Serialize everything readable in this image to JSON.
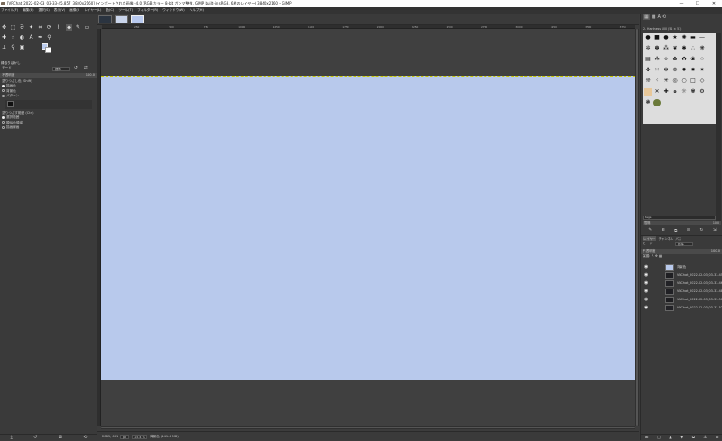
{
  "titlebar": {
    "title": "[VRChat_2022-02-03_03-33-45.857_3840x2160] (インポートされた画像)-4.0 (RGB カラー 8-bit ガンマ整数, GIMP built-in sRGB, 6枚のレイヤー) 3840x2160 – GIMP",
    "min": "—",
    "max": "☐",
    "close": "✕"
  },
  "menubar": {
    "items": [
      "ファイル(F)",
      "編集(E)",
      "選択(S)",
      "表示(V)",
      "画像(I)",
      "レイヤー(L)",
      "色(C)",
      "ツール(T)",
      "フィルター(R)",
      "ウィンドウ(W)",
      "ヘルプ(H)"
    ]
  },
  "toolbox": {
    "fg_color": "#bbccee",
    "bg_color": "#ffffff"
  },
  "tool_options": {
    "title": "縁取りぼかし",
    "mode_label": "モード",
    "mode_value": "標準",
    "opacity_label": "不透明度",
    "opacity_value": "100.0",
    "fill_type_label": "塗りつぶし色 (Shift)",
    "fill_types": [
      "描画色",
      "背景色",
      "パターン"
    ],
    "affected_label": "塗りつぶす範囲 (Ctrl)",
    "affected": [
      "選択範囲",
      "類似色領域",
      "描画線画"
    ]
  },
  "image_tabs": {
    "thumbs": [
      "#2b3440",
      "#c9d4ea",
      "#b8c9ee"
    ]
  },
  "ruler": {
    "ticks": [
      "250",
      "500",
      "750",
      "1000",
      "1250",
      "1500",
      "1750",
      "2000",
      "2250",
      "2500",
      "2750",
      "3000",
      "3250",
      "3500",
      "3750"
    ]
  },
  "canvas": {
    "fill": "#b8c9ec"
  },
  "statusbar": {
    "coords": "2085, 601",
    "unit": "px",
    "zoom": "15.4 %",
    "info": "背景色 (141.4 MB)"
  },
  "brushes": {
    "header": "2. Hardness 100 (51 × 51)",
    "filter_label": "tags",
    "spacing_label": "間隔",
    "spacing_value": "10.0"
  },
  "layers_panel": {
    "tabs": [
      "レイヤー",
      "チャンネル",
      "パス"
    ],
    "mode_label": "モード",
    "mode_value": "標準",
    "opacity_label": "不透明度",
    "opacity_value": "100.0",
    "lock_label": "保護:",
    "layers": [
      {
        "name": "背景色",
        "thumb": "#b8c9ec"
      },
      {
        "name": "VRChat_2022-02-03_03-33-45",
        "thumb": "#1f1f22"
      },
      {
        "name": "VRChat_2022-02-03_03-33-46",
        "thumb": "#222226"
      },
      {
        "name": "VRChat_2022-02-03_03-33-48",
        "thumb": "#202024"
      },
      {
        "name": "VRChat_2022-02-03_03-33-50",
        "thumb": "#1e1e21"
      },
      {
        "name": "VRChat_2022-02-03_03-33-52",
        "thumb": "#232327"
      }
    ]
  }
}
